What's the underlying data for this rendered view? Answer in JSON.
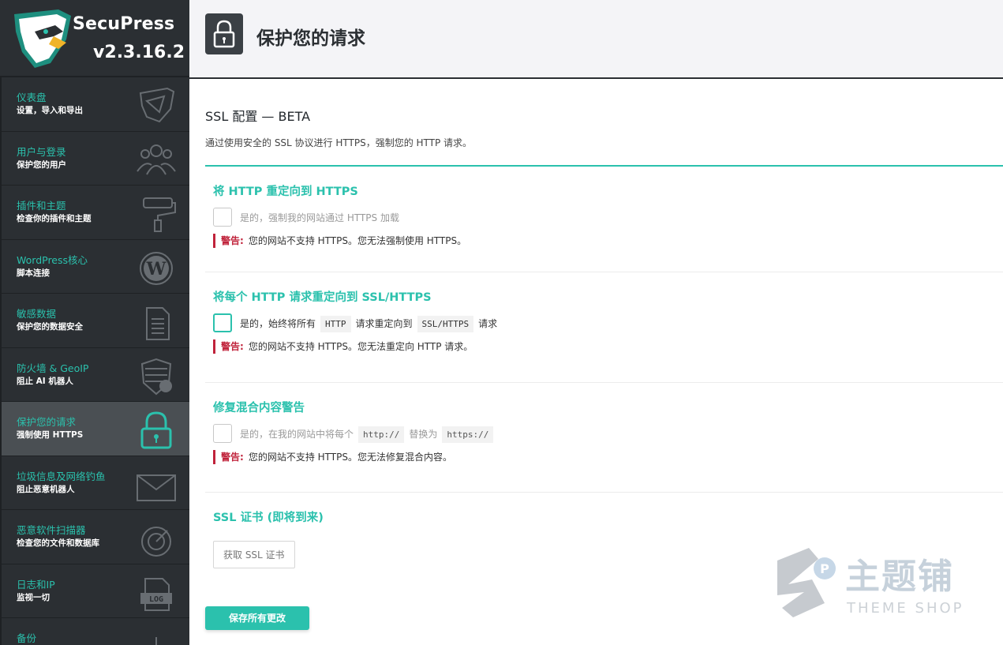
{
  "brand": {
    "name": "SecuPress",
    "version": "v2.3.16.2"
  },
  "nav": [
    {
      "title": "仪表盘",
      "sub": "设置，导入和导出",
      "icon": "shield-icon"
    },
    {
      "title": "用户与登录",
      "sub": "保护您的用户",
      "icon": "users-icon"
    },
    {
      "title": "插件和主题",
      "sub": "检查你的插件和主题",
      "icon": "paint-roller-icon"
    },
    {
      "title": "WordPress核心",
      "sub": "脚本连接",
      "icon": "wordpress-icon"
    },
    {
      "title": "敏感数据",
      "sub": "保护您的数据安全",
      "icon": "document-icon"
    },
    {
      "title": "防火墙 & GeoIP",
      "sub": "阻止 AI 机器人",
      "icon": "firewall-icon"
    },
    {
      "title": "保护您的请求",
      "sub": "强制使用 HTTPS",
      "icon": "lock-icon"
    },
    {
      "title": "垃圾信息及网络钓鱼",
      "sub": "阻止恶意机器人",
      "icon": "envelope-icon"
    },
    {
      "title": "恶意软件扫描器",
      "sub": "检查您的文件和数据库",
      "icon": "radar-icon"
    },
    {
      "title": "日志和IP",
      "sub": "监视一切",
      "icon": "log-file-icon"
    },
    {
      "title": "备份",
      "sub": "",
      "icon": "backup-icon"
    }
  ],
  "header": {
    "title": "保护您的请求",
    "icon": "lock-icon"
  },
  "section": {
    "title": "SSL 配置 — BETA",
    "desc": "通过使用安全的 SSL 协议进行 HTTPS，强制您的 HTTP 请求。"
  },
  "blocks": {
    "b1": {
      "heading": "将 HTTP 重定向到 HTTPS",
      "label": "是的，强制我的网站通过 HTTPS 加载",
      "warn_tag": "警告:",
      "warn_text": "您的网站不支持 HTTPS。您无法强制使用 HTTPS。"
    },
    "b2": {
      "heading": "将每个 HTTP 请求重定向到 SSL/HTTPS",
      "label_a": "是的，始终将所有",
      "code_a": "HTTP",
      "label_b": "请求重定向到",
      "code_b": "SSL/HTTPS",
      "label_c": "请求",
      "warn_tag": "警告:",
      "warn_text": "您的网站不支持 HTTPS。您无法重定向 HTTP 请求。"
    },
    "b3": {
      "heading": "修复混合内容警告",
      "label_a": "是的，在我的网站中将每个",
      "code_a": "http://",
      "label_b": "替换为",
      "code_b": "https://",
      "warn_tag": "警告:",
      "warn_text": "您的网站不支持 HTTPS。您无法修复混合内容。"
    },
    "b4": {
      "heading": "SSL 证书 (即将到来)",
      "button": "获取 SSL 证书"
    }
  },
  "save_button": "保存所有更改",
  "watermark": {
    "cn": "主题铺",
    "en": "THEME SHOP"
  },
  "colors": {
    "accent": "#2bc1ad",
    "sidebar": "#2b2f33",
    "warning": "#c0233b"
  }
}
